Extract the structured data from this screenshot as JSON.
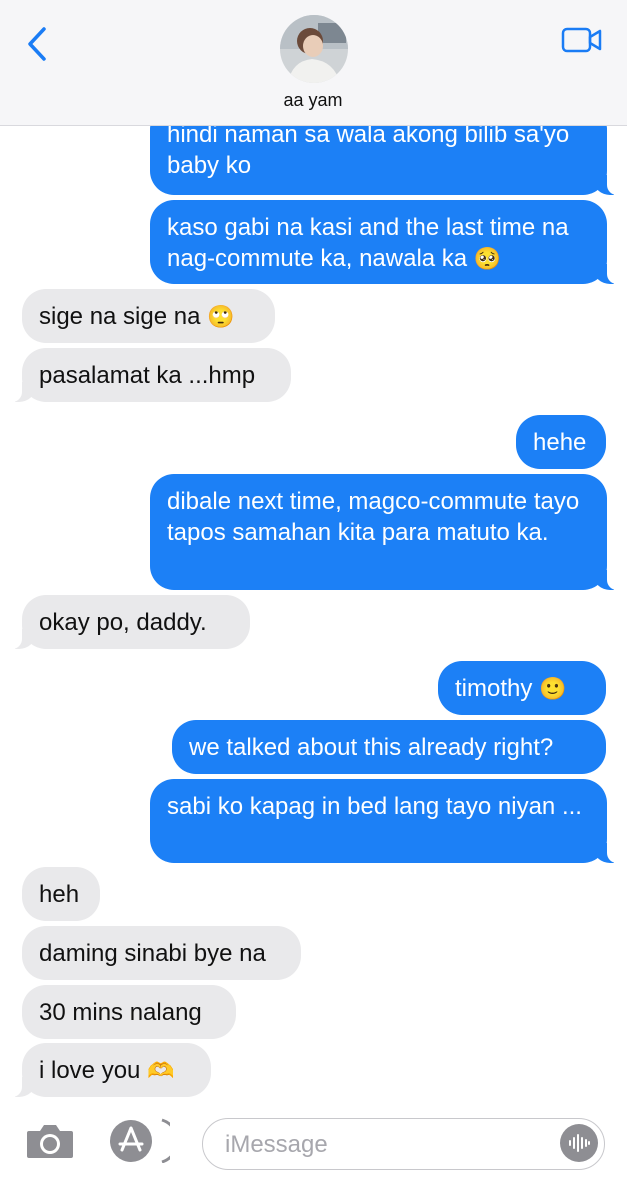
{
  "header": {
    "contact_name": "aa yam"
  },
  "messages": [
    {
      "dir": "out",
      "text": "hindi naman sa wala akong bilib sa'yo baby ko",
      "tail": true
    },
    {
      "dir": "out",
      "text": "kaso gabi na kasi and the last time na nag-commute ka, nawala ka",
      "emoji": "🥺",
      "tail": true
    },
    {
      "dir": "in",
      "text": "sige na sige na",
      "emoji": "🙄",
      "tail": false
    },
    {
      "dir": "in",
      "text": "pasalamat ka ...hmp",
      "tail": true
    },
    {
      "dir": "out",
      "text": "hehe",
      "tail": false
    },
    {
      "dir": "out",
      "text": "dibale next time, magco-commute tayo tapos samahan kita para matuto ka.",
      "tail": true
    },
    {
      "dir": "in",
      "text": "okay po, daddy.",
      "tail": true
    },
    {
      "dir": "out",
      "text": "timothy",
      "emoji": "🙂",
      "tail": false
    },
    {
      "dir": "out",
      "text": "we talked about this already right?",
      "tail": false
    },
    {
      "dir": "out",
      "text": "sabi ko kapag in bed lang tayo niyan ...",
      "tail": true
    },
    {
      "dir": "in",
      "text": "heh",
      "tail": false
    },
    {
      "dir": "in",
      "text": "daming sinabi bye na",
      "tail": false
    },
    {
      "dir": "in",
      "text": "30 mins nalang",
      "tail": false
    },
    {
      "dir": "in",
      "text": "i love you",
      "emoji": "🫶",
      "tail": true
    }
  ],
  "composer": {
    "placeholder": "iMessage"
  },
  "colors": {
    "outgoing_bubble": "#1c80f6",
    "incoming_bubble": "#e9e9eb",
    "accent": "#1a7cf5"
  },
  "icons": {
    "back": "chevron-left-icon",
    "video": "video-camera-icon",
    "camera": "camera-icon",
    "apps": "app-store-icon",
    "audio": "audio-waveform-icon"
  }
}
